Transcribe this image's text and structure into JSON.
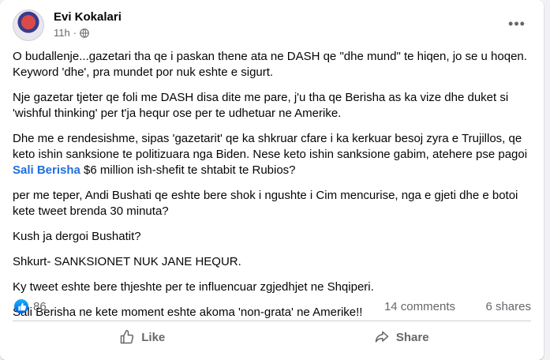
{
  "post": {
    "author": "Evi Kokalari",
    "time": "11h",
    "audience_icon": "globe-icon",
    "paragraphs": [
      "O budallenje...gazetari tha qe i paskan thene ata ne DASH qe \"dhe mund\" te hiqen, jo se u hoqen. Keyword 'dhe', pra mundet por nuk eshte e sigurt.",
      "Nje gazetar tjeter qe foli me DASH disa dite me pare, j'u tha qe Berisha as ka vize dhe duket si 'wishful thinking' per t'ja hequr ose per te udhetuar ne Amerike.",
      "per me teper, Andi Bushati qe eshte bere shok i ngushte i Cim mencurise, nga e gjeti dhe e botoi kete tweet brenda 30 minuta?",
      "Kush ja dergoi Bushatit?",
      "Shkurt- SANKSIONET NUK JANE HEQUR.",
      "Ky tweet eshte bere thjeshte per te influencuar zgjedhjet ne Shqiperi.",
      "Sali Berisha ne kete moment eshte akoma 'non-grata' ne Amerike!!"
    ],
    "paragraph3": {
      "before": "Dhe me e rendesishme, sipas 'gazetarit' qe ka shkruar cfare i ka kerkuar besoj zyra e Trujillos, qe keto ishin sanksione te politizuara nga Biden. Nese keto ishin sanksione gabim, atehere pse pagoi ",
      "mention": "Sali Berisha",
      "after": " $6 million ish-shefit te shtabit te Rubios?"
    }
  },
  "stats": {
    "reactions": "86",
    "comments": "14 comments",
    "shares": "6 shares"
  },
  "actions": {
    "like": "Like",
    "share": "Share"
  },
  "colors": {
    "link": "#216fdb",
    "muted": "#65676b",
    "like_blue": "#0866ff"
  }
}
